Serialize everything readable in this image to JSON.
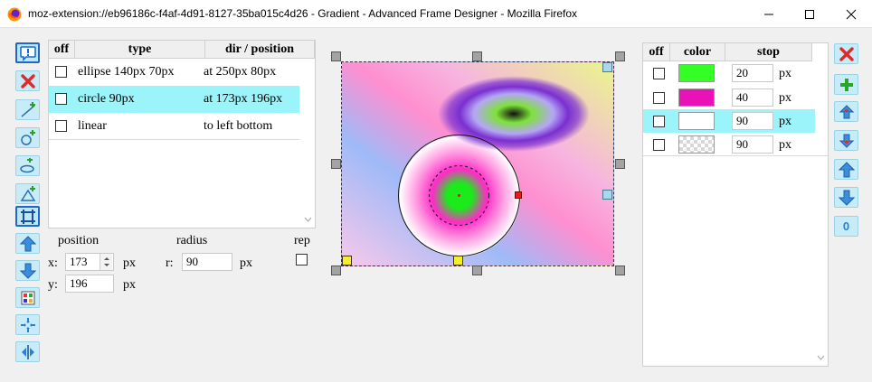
{
  "window": {
    "title": "moz-extension://eb96186c-f4af-4d91-8127-35ba015c4d26 - Gradient - Advanced Frame Designer - Mozilla Firefox",
    "icon": "firefox-icon"
  },
  "layers": {
    "headers": {
      "off": "off",
      "type": "type",
      "dir": "dir / position"
    },
    "rows": [
      {
        "type": "ellipse 140px 70px",
        "dir": "at 250px 80px"
      },
      {
        "type": "circle 90px",
        "dir": "at 173px 196px"
      },
      {
        "type": "linear",
        "dir": "to left bottom"
      }
    ]
  },
  "position": {
    "label": "position",
    "x_label": "x:",
    "x_value": "173",
    "x_unit": "px",
    "y_label": "y:",
    "y_value": "196",
    "y_unit": "px"
  },
  "radius": {
    "label": "radius",
    "r_label": "r:",
    "r_value": "90",
    "r_unit": "px"
  },
  "rep": {
    "label": "rep"
  },
  "stops": {
    "headers": {
      "off": "off",
      "color": "color",
      "stop": "stop"
    },
    "rows": [
      {
        "color": "#33ff22",
        "value": "20",
        "unit": "px"
      },
      {
        "color": "#e812b8",
        "value": "40",
        "unit": "px"
      },
      {
        "color": "#ffffff",
        "value": "90",
        "unit": "px"
      },
      {
        "color": "transparent",
        "value": "90",
        "unit": "px"
      }
    ]
  },
  "zero_button": {
    "label": "0"
  }
}
